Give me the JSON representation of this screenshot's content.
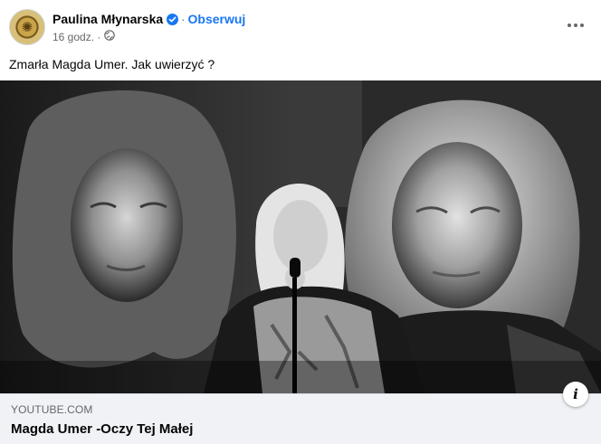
{
  "post": {
    "author": "Paulina Młynarska",
    "follow_label": "Obserwuj",
    "separator": "·",
    "timestamp": "16 godz. ·",
    "text": "Zmarła Magda Umer. Jak uwierzyć ?"
  },
  "link_preview": {
    "domain": "YOUTUBE.COM",
    "title": "Magda Umer -Oczy Tej Małej",
    "info_glyph": "i"
  },
  "icons": {
    "verified": "verified-badge-icon",
    "audience": "globe-icon",
    "more": "more-options-icon",
    "info": "info-icon"
  },
  "colors": {
    "accent": "#1877f2",
    "secondary_text": "#65676b",
    "preview_bg": "#f0f2f5"
  }
}
